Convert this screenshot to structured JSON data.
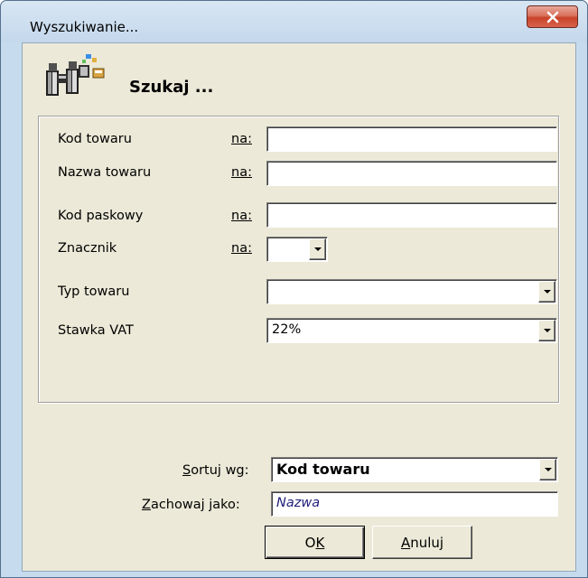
{
  "window": {
    "title": "Wyszukiwanie...",
    "close_glyph": "X"
  },
  "header": {
    "icon": "binoculars-icon",
    "title": "Szukaj ..."
  },
  "filters": {
    "na_label": "na:",
    "kod_towaru": {
      "label": "Kod towaru",
      "value": ""
    },
    "nazwa_towaru": {
      "label": "Nazwa towaru",
      "value": ""
    },
    "kod_paskowy": {
      "label": "Kod paskowy",
      "value": ""
    },
    "znacznik": {
      "label": "Znacznik",
      "value": ""
    },
    "typ_towaru": {
      "label": "Typ towaru",
      "value": ""
    },
    "stawka_vat": {
      "label": "Stawka VAT",
      "value": "22%"
    }
  },
  "sort": {
    "label_prefix": "S",
    "label_rest": "ortuj wg:",
    "value": "Kod towaru"
  },
  "save_as": {
    "label_prefix": "Z",
    "label_rest": "achowaj jako:",
    "placeholder": "Nazwa"
  },
  "buttons": {
    "ok_prefix": "O",
    "ok_rest": "K",
    "cancel_prefix": "A",
    "cancel_rest": "nuluj"
  },
  "colors": {
    "window_frame": "#c7dbee",
    "dialog_face": "#ece9d8",
    "close_button": "#c7432a",
    "placeholder_text": "#1f1f7a"
  }
}
